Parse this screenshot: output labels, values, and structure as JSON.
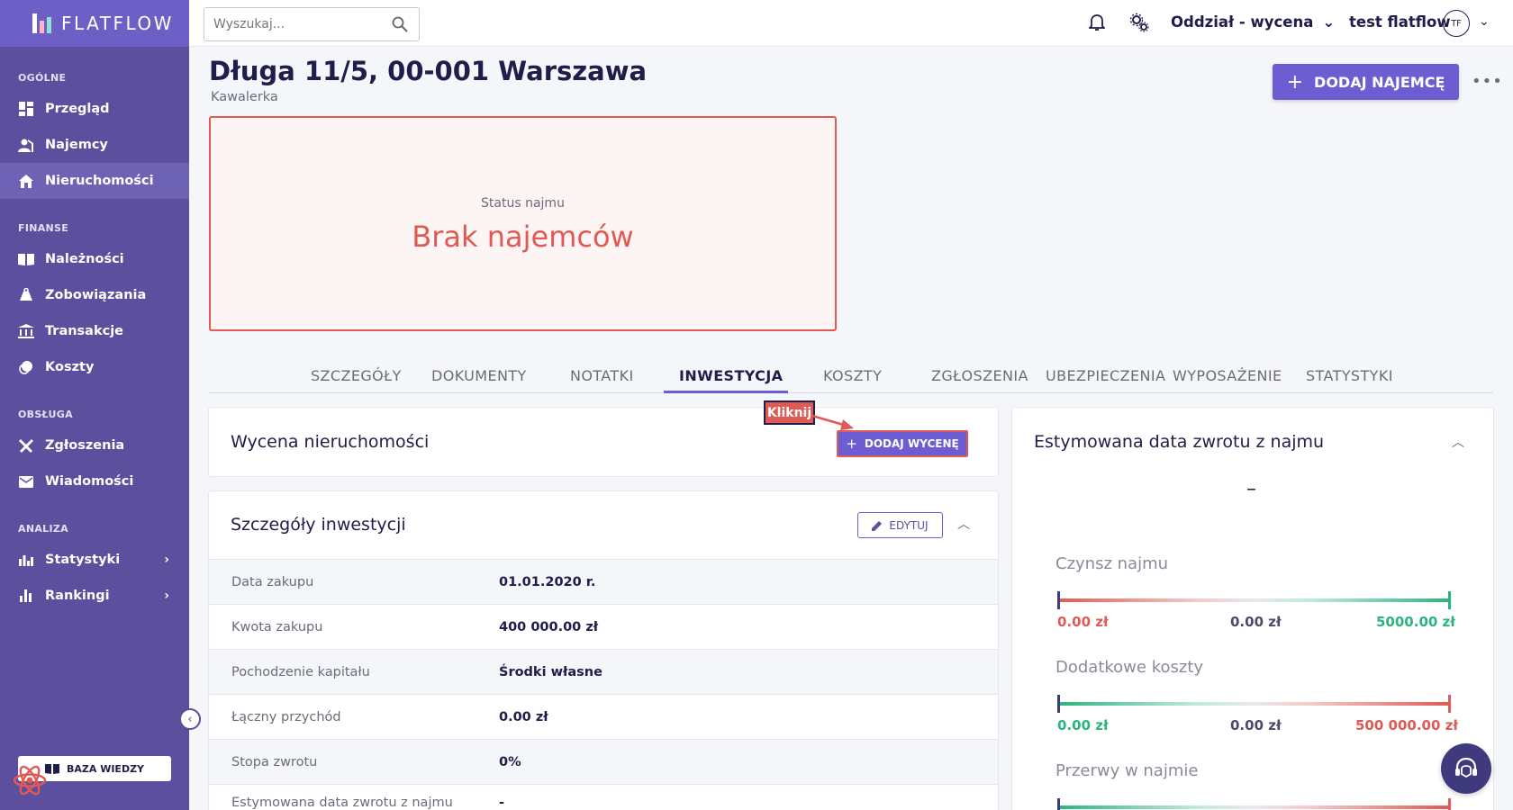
{
  "app": {
    "name": "FLATFLOW"
  },
  "search": {
    "placeholder": "Wyszukaj..."
  },
  "topbar": {
    "branch": "Oddział - wycena",
    "user": "test flatflow",
    "avatar_initials": "TF"
  },
  "sidebar": {
    "sections": [
      {
        "title": "OGÓLNE",
        "items": [
          {
            "label": "Przegląd",
            "icon": "dashboard-icon"
          },
          {
            "label": "Najemcy",
            "icon": "tenants-icon"
          },
          {
            "label": "Nieruchomości",
            "icon": "home-icon",
            "active": true
          }
        ]
      },
      {
        "title": "FINANSE",
        "items": [
          {
            "label": "Należności",
            "icon": "book-icon"
          },
          {
            "label": "Zobowiązania",
            "icon": "bag-icon"
          },
          {
            "label": "Transakcje",
            "icon": "bank-icon"
          },
          {
            "label": "Koszty",
            "icon": "coins-icon"
          }
        ]
      },
      {
        "title": "OBSŁUGA",
        "items": [
          {
            "label": "Zgłoszenia",
            "icon": "tools-icon"
          },
          {
            "label": "Wiadomości",
            "icon": "mail-icon"
          }
        ]
      },
      {
        "title": "ANALIZA",
        "items": [
          {
            "label": "Statystyki",
            "icon": "stats-icon"
          },
          {
            "label": "Rankingi",
            "icon": "ranking-icon"
          }
        ]
      }
    ],
    "kb_label": "BAZA WIEDZY"
  },
  "header": {
    "title": "Długa 11/5, 00-001 Warszawa",
    "subtitle": "Kawalerka",
    "add_tenant_label": "DODAJ NAJEMCĘ"
  },
  "status": {
    "label": "Status najmu",
    "value": "Brak najemców"
  },
  "tabs": [
    "SZCZEGÓŁY",
    "DOKUMENTY",
    "NOTATKI",
    "INWESTYCJA",
    "KOSZTY",
    "ZGŁOSZENIA",
    "UBEZPIECZENIA",
    "WYPOSAŻENIE",
    "STATYSTYKI"
  ],
  "active_tab": "INWESTYCJA",
  "valuation": {
    "title": "Wycena nieruchomości",
    "add_label": "DODAJ WYCENĘ",
    "annotation": "Kliknij"
  },
  "investment": {
    "title": "Szczegóły inwestycji",
    "edit_label": "EDYTUJ",
    "rows": [
      {
        "label": "Data zakupu",
        "value": "01.01.2020 r."
      },
      {
        "label": "Kwota zakupu",
        "value": "400 000.00 zł"
      },
      {
        "label": "Pochodzenie kapitału",
        "value": "Środki własne"
      },
      {
        "label": "Łączny przychód",
        "value": "0.00 zł"
      },
      {
        "label": "Stopa zwrotu",
        "value": "0%"
      },
      {
        "label": "Estymowana data zwrotu z najmu",
        "value": "-"
      }
    ]
  },
  "estimate": {
    "title": "Estymowana data zwrotu z najmu",
    "value": "–",
    "metrics": [
      {
        "title": "Czynsz najmu",
        "min": "0.00 zł",
        "current": "0.00 zł",
        "max": "5000.00 zł",
        "direction": "red-to-green"
      },
      {
        "title": "Dodatkowe koszty",
        "min": "0.00 zł",
        "current": "0.00 zł",
        "max": "500 000.00 zł",
        "direction": "green-to-red"
      },
      {
        "title": "Przerwy w najmie",
        "direction": "green-to-red"
      }
    ]
  },
  "colors": {
    "sidebar": "#5b4f9e",
    "accent": "#6c5ed2",
    "danger": "#e05a55",
    "success": "#2bb47d"
  }
}
